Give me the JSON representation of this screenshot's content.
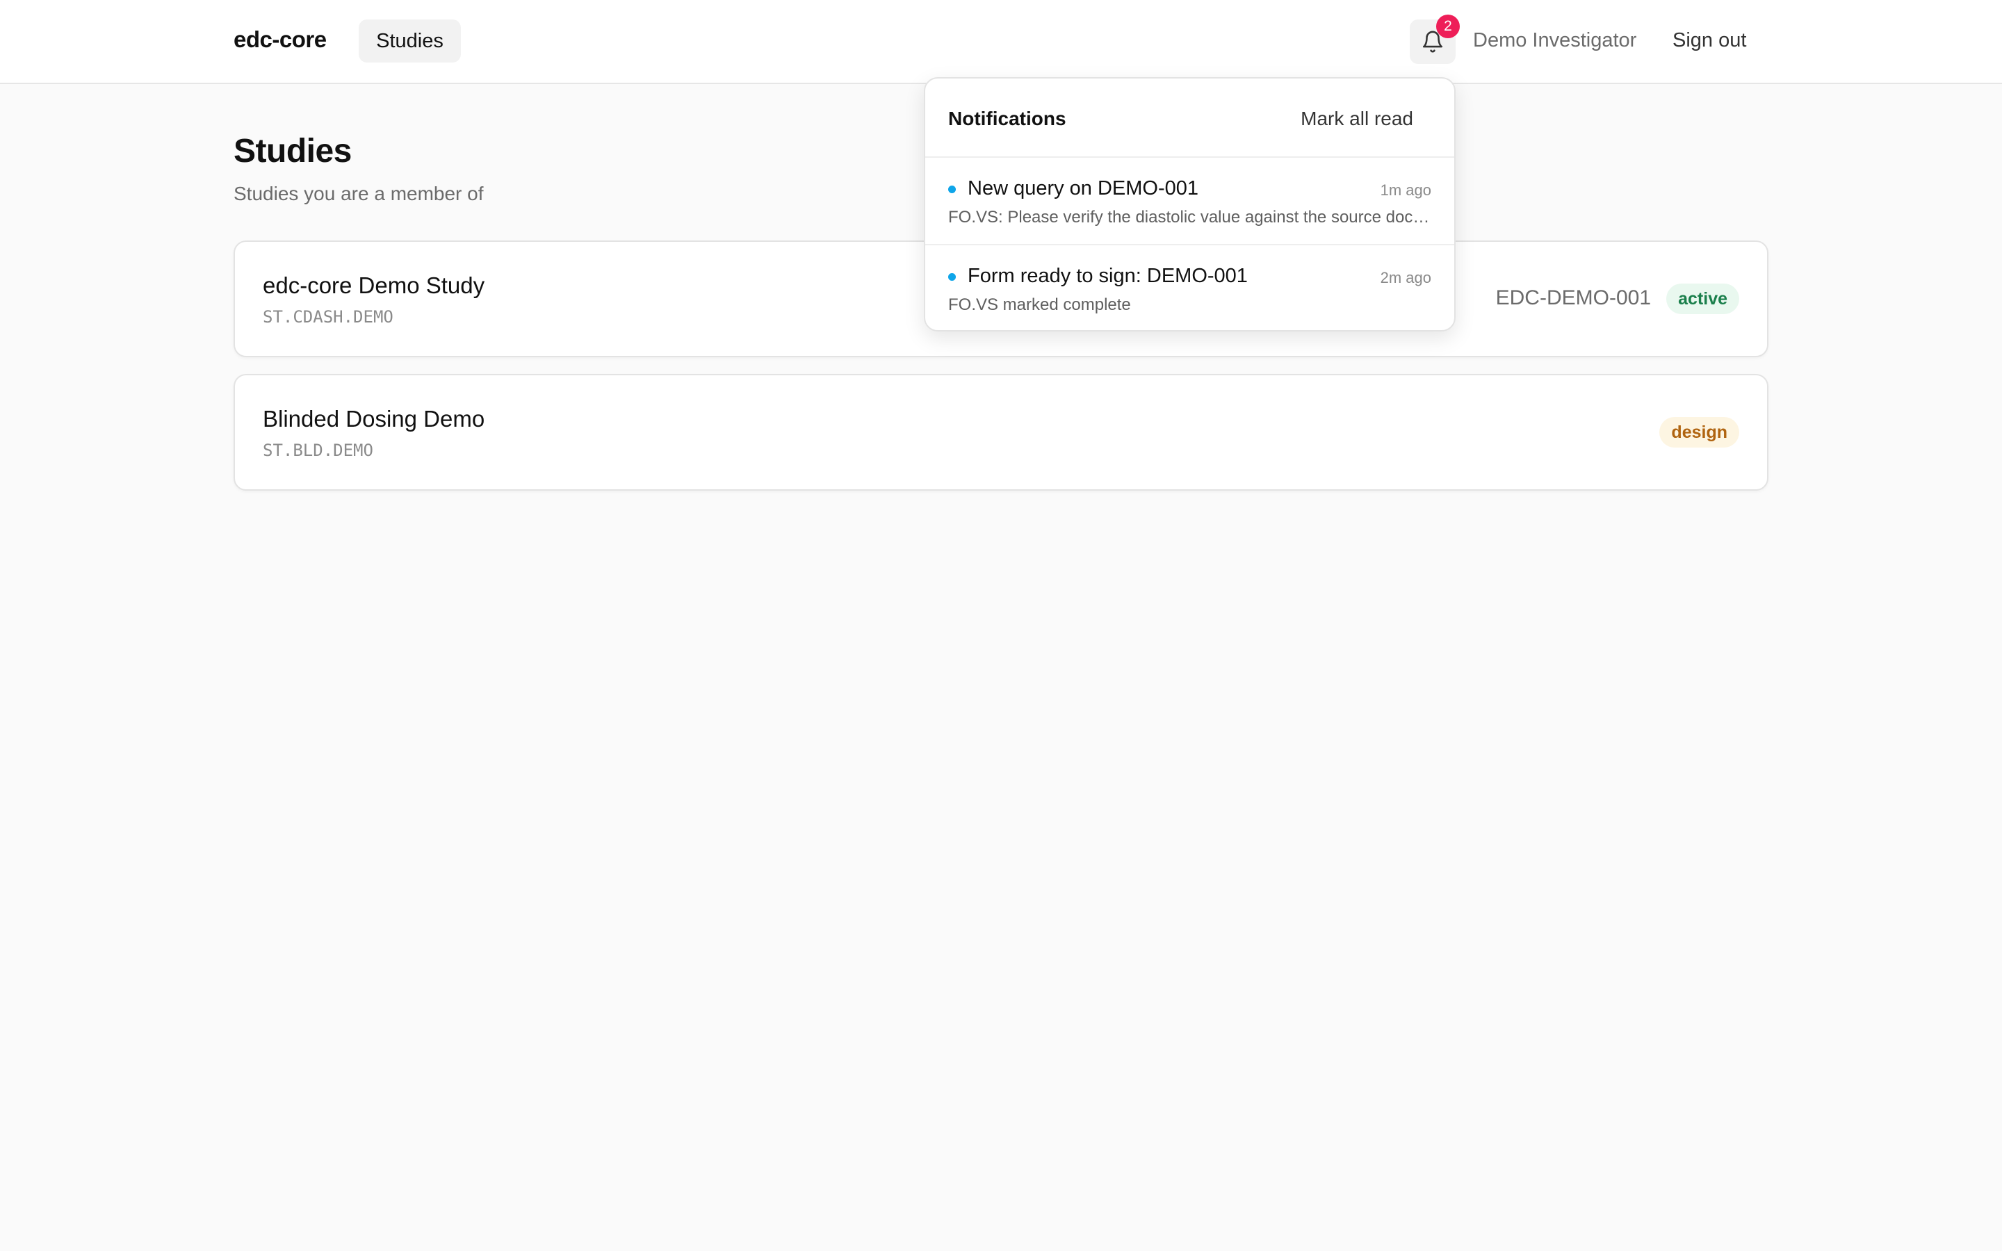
{
  "header": {
    "brand": "edc-core",
    "nav_studies": "Studies",
    "notification_count": "2",
    "user_name": "Demo Investigator",
    "sign_out": "Sign out"
  },
  "page": {
    "title": "Studies",
    "subtitle": "Studies you are a member of"
  },
  "studies": [
    {
      "name": "edc-core Demo Study",
      "code": "ST.CDASH.DEMO",
      "protocol": "EDC-DEMO-001",
      "status": "active"
    },
    {
      "name": "Blinded Dosing Demo",
      "code": "ST.BLD.DEMO",
      "protocol": "",
      "status": "design"
    }
  ],
  "notifications": {
    "title": "Notifications",
    "mark_all_read": "Mark all read",
    "items": [
      {
        "title": "New query on DEMO-001",
        "time": "1m ago",
        "body": "FO.VS: Please verify the diastolic value against the source document",
        "unread": true
      },
      {
        "title": "Form ready to sign: DEMO-001",
        "time": "2m ago",
        "body": "FO.VS marked complete",
        "unread": true
      }
    ]
  },
  "colors": {
    "accent_dot": "#0ea5e9",
    "badge_red": "#ee1e58",
    "status_active": "#1a7f4b",
    "status_design": "#b06410"
  },
  "icons": {
    "bell": "bell-icon",
    "unread": "unread-dot-icon"
  }
}
